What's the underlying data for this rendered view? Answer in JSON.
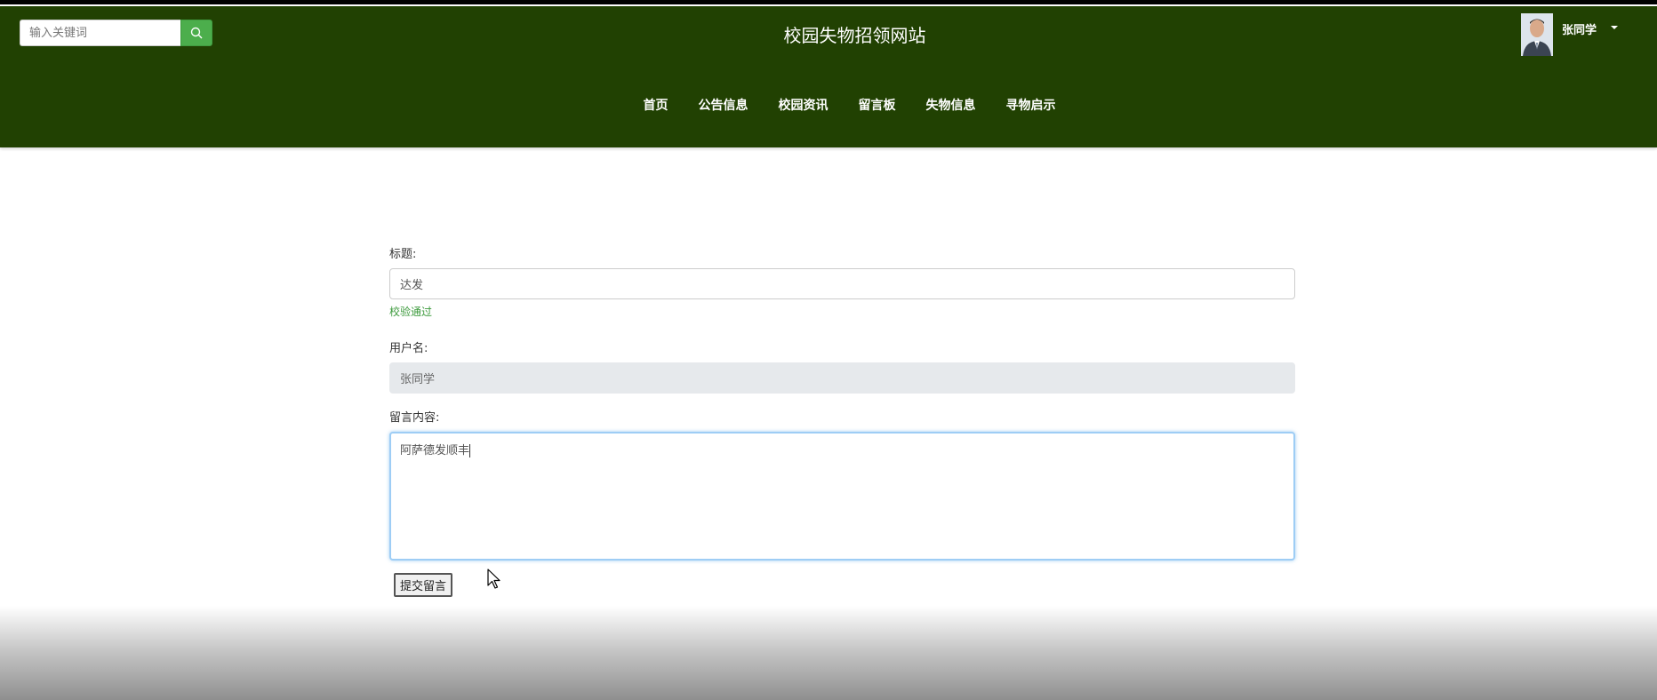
{
  "header": {
    "search_placeholder": "输入关键词",
    "site_title": "校园失物招领网站",
    "user_name": "张同学",
    "nav": [
      {
        "label": "首页"
      },
      {
        "label": "公告信息"
      },
      {
        "label": "校园资讯"
      },
      {
        "label": "留言板"
      },
      {
        "label": "失物信息"
      },
      {
        "label": "寻物启示"
      }
    ]
  },
  "form": {
    "title_label": "标题:",
    "title_value": "达发",
    "title_valid_msg": "校验通过",
    "username_label": "用户名:",
    "username_value": "张同学",
    "content_label": "留言内容:",
    "content_value": "阿萨德发顺丰",
    "submit_label": "提交留言"
  },
  "colors": {
    "header_bg": "#214102",
    "search_button": "#4cae4c",
    "valid_text": "#3c9a3c",
    "focus_border": "#9ecdf5"
  },
  "icons": {
    "search": "search-icon",
    "caret": "caret-down-icon",
    "pointer": "mouse-pointer-icon"
  }
}
